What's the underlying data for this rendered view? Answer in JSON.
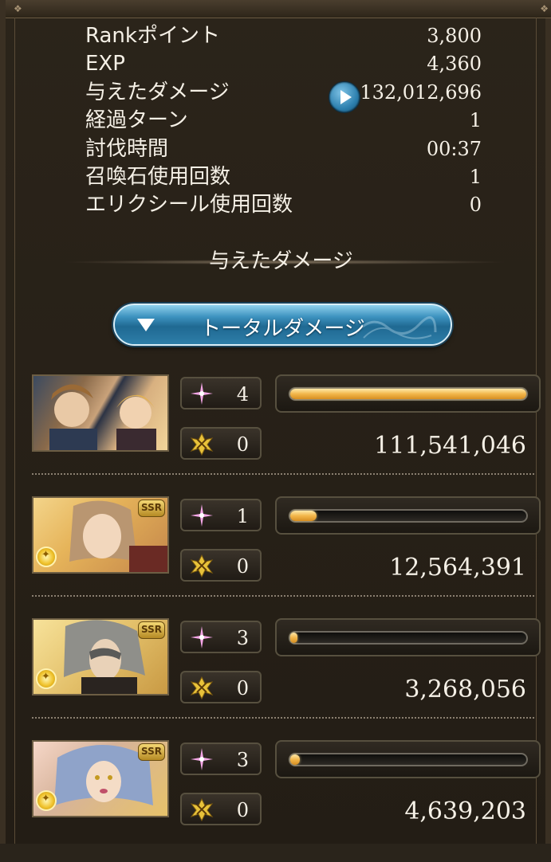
{
  "stats": [
    {
      "label": "Rankポイント",
      "value": "3,800"
    },
    {
      "label": "EXP",
      "value": "4,360"
    },
    {
      "label": "与えたダメージ",
      "value": "132,012,696"
    },
    {
      "label": "経過ターン",
      "value": "1"
    },
    {
      "label": "討伐時間",
      "value": "00:37"
    },
    {
      "label": "召喚石使用回数",
      "value": "1"
    },
    {
      "label": "エリクシール使用回数",
      "value": "0"
    }
  ],
  "damage_section": {
    "title": "与えたダメージ",
    "toggle_label": "トータルダメージ"
  },
  "characters": [
    {
      "ssr": "",
      "skill_count": "4",
      "ougi_count": "0",
      "damage": "111,541,046",
      "share": 1.0
    },
    {
      "ssr": "SSR",
      "skill_count": "1",
      "ougi_count": "0",
      "damage": "12,564,391",
      "share": 0.113
    },
    {
      "ssr": "SSR",
      "skill_count": "3",
      "ougi_count": "0",
      "damage": "3,268,056",
      "share": 0.029
    },
    {
      "ssr": "SSR",
      "skill_count": "3",
      "ougi_count": "0",
      "damage": "4,639,203",
      "share": 0.042
    }
  ],
  "colors": {
    "accent_blue": "#2c7fae",
    "bar_gold": "#f2b64a",
    "skill_pink": "#f4a6e6",
    "ougi_gold": "#e8c23a"
  },
  "icons": {
    "skill": "pink-sparkle-icon",
    "ougi": "gold-burst-icon",
    "element": "light-element-icon",
    "play": "play-icon",
    "toggle": "triangle-down-icon"
  }
}
